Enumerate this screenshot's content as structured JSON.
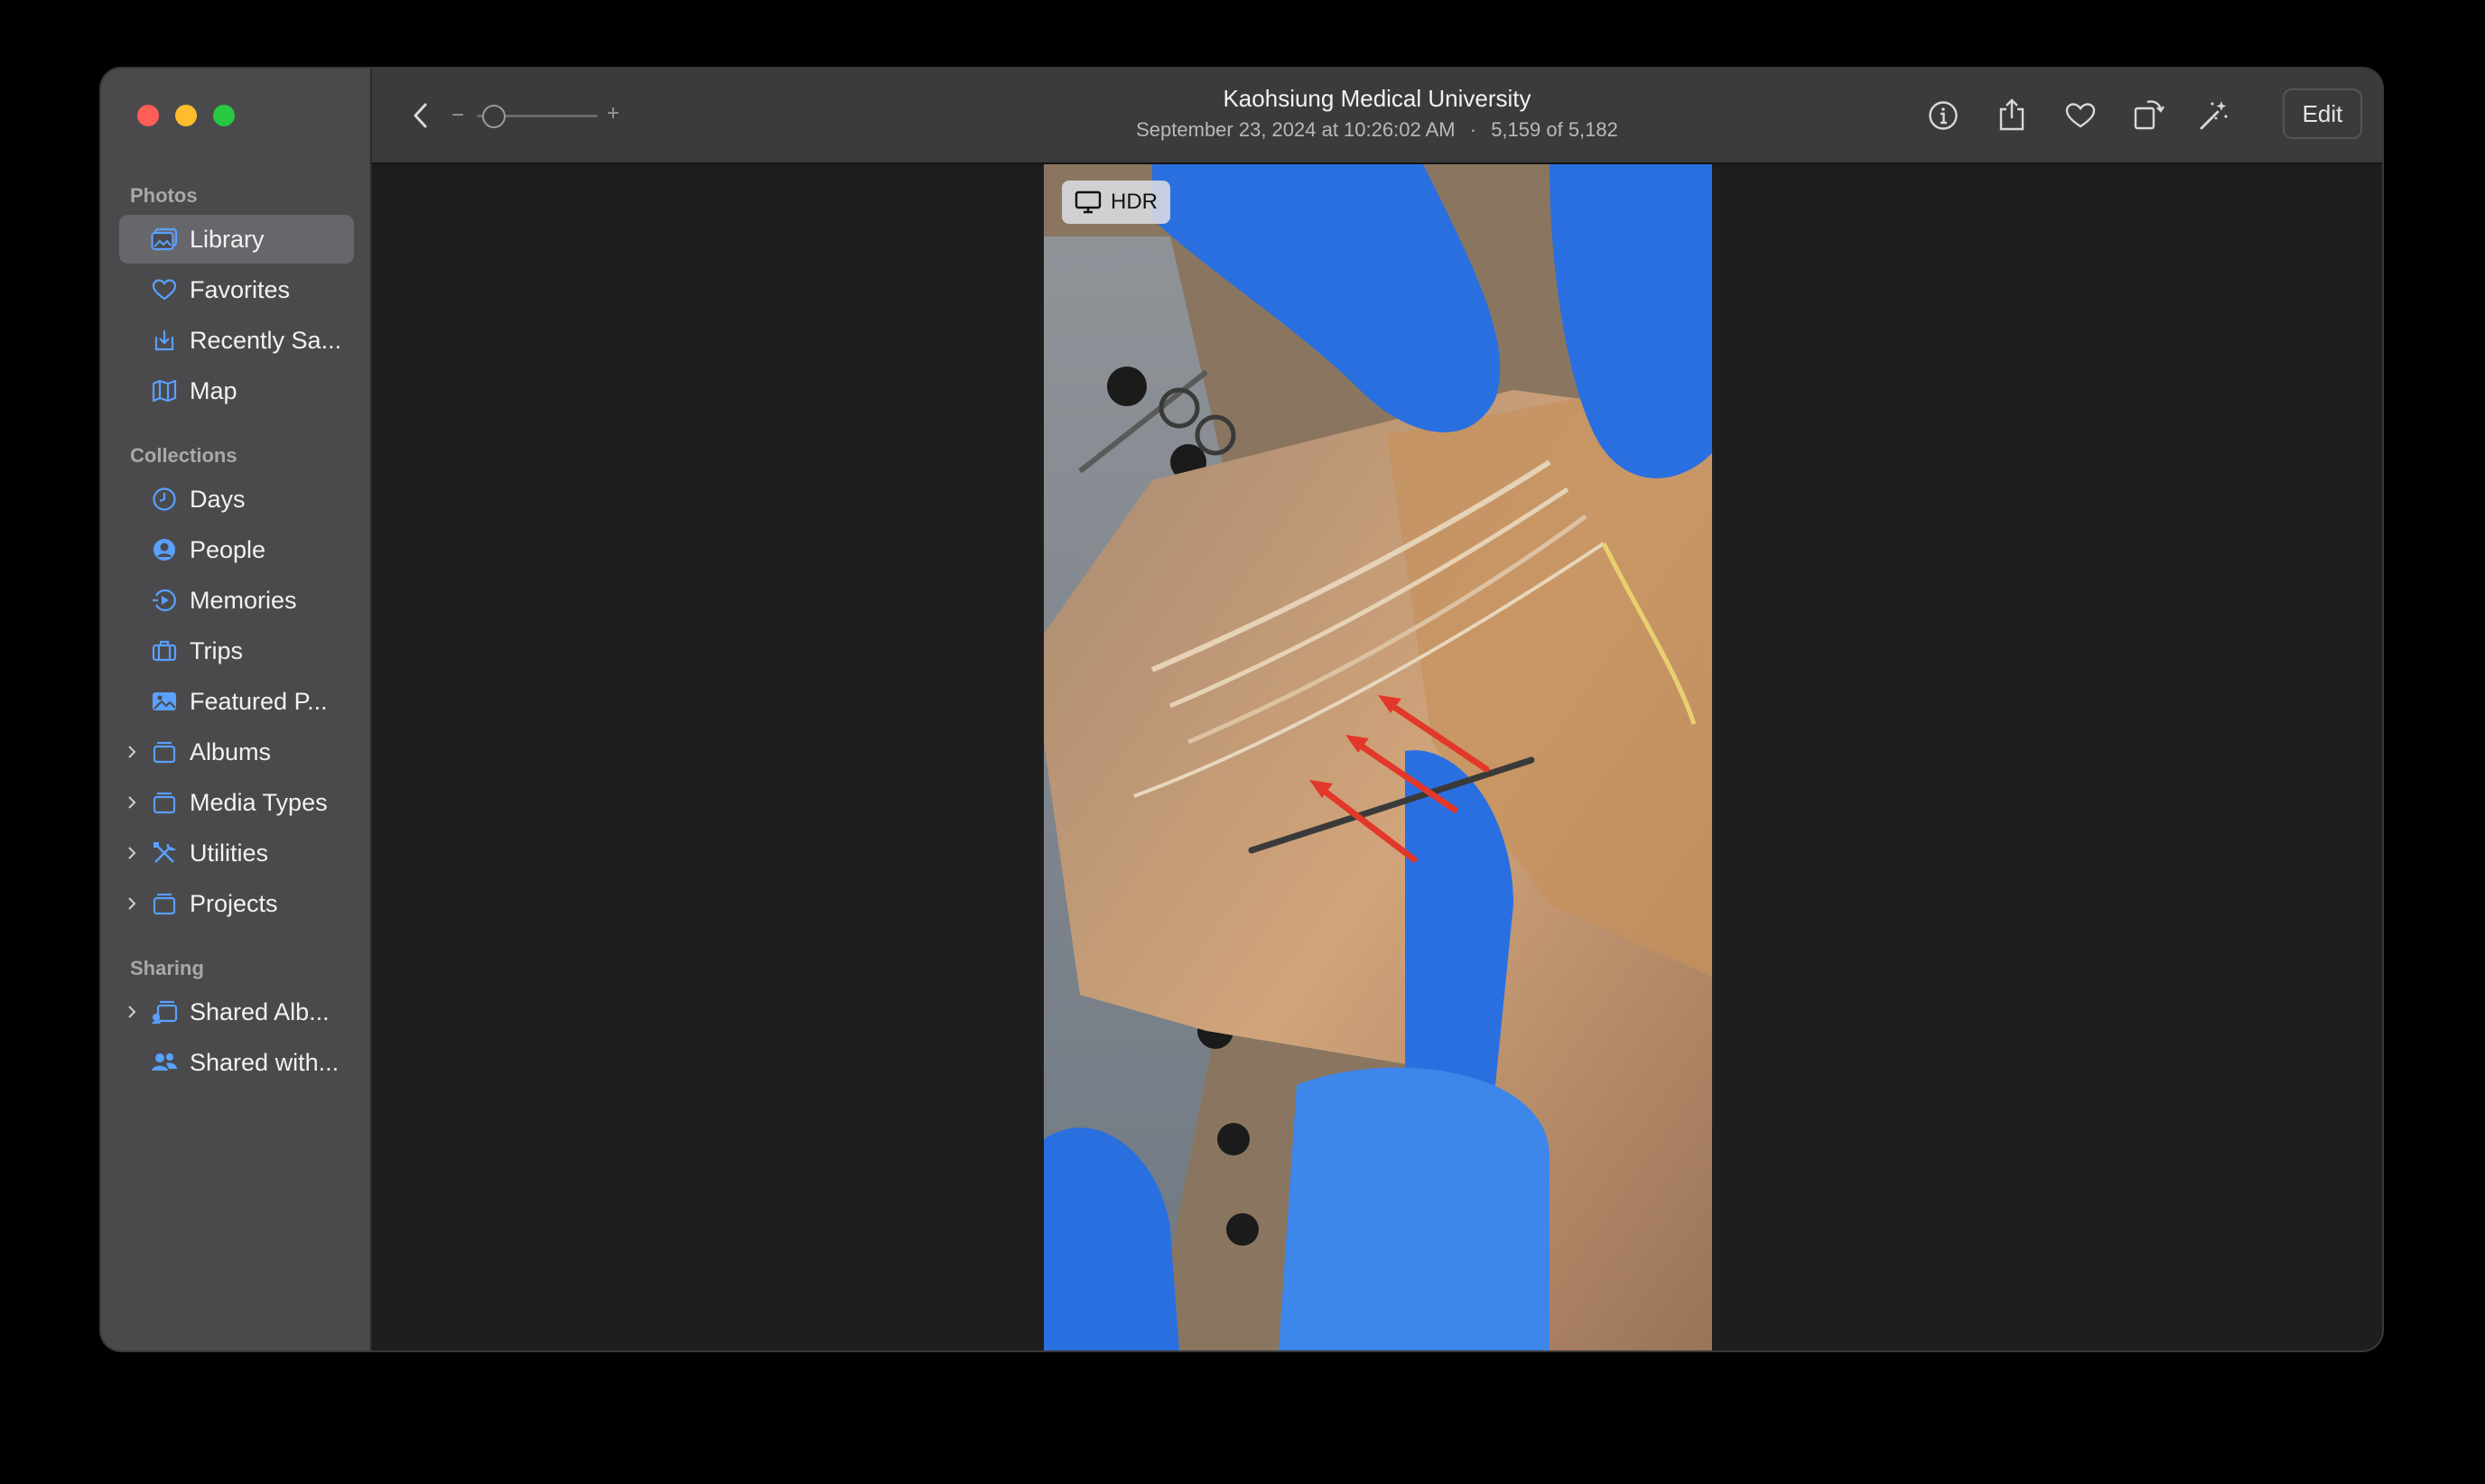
{
  "window": {
    "title": "Kaohsiung Medical University",
    "subtitle_date": "September 23, 2024 at 10:26:02 AM",
    "subtitle_sep": "·",
    "subtitle_position": "5,159 of 5,182"
  },
  "toolbar": {
    "zoom_minus": "−",
    "zoom_plus": "+",
    "zoom_level": 0.05,
    "edit_label": "Edit"
  },
  "sidebar": {
    "sections": [
      {
        "title": "Photos"
      },
      {
        "title": "Collections"
      },
      {
        "title": "Sharing"
      }
    ],
    "items": [
      {
        "label": "Library",
        "icon": "library-icon",
        "selected": true
      },
      {
        "label": "Favorites",
        "icon": "heart-icon"
      },
      {
        "label": "Recently Sa...",
        "icon": "recently-saved-icon"
      },
      {
        "label": "Map",
        "icon": "map-icon"
      },
      {
        "label": "Days",
        "icon": "clock-icon"
      },
      {
        "label": "People",
        "icon": "person-icon"
      },
      {
        "label": "Memories",
        "icon": "memories-icon"
      },
      {
        "label": "Trips",
        "icon": "suitcase-icon"
      },
      {
        "label": "Featured P...",
        "icon": "photo-icon"
      },
      {
        "label": "Albums",
        "icon": "folder-icon",
        "expandable": true
      },
      {
        "label": "Media Types",
        "icon": "folder-icon",
        "expandable": true
      },
      {
        "label": "Utilities",
        "icon": "tools-icon",
        "expandable": true
      },
      {
        "label": "Projects",
        "icon": "folder-icon",
        "expandable": true
      },
      {
        "label": "Shared Alb...",
        "icon": "shared-albums-icon",
        "expandable": true
      },
      {
        "label": "Shared with...",
        "icon": "shared-with-you-icon"
      }
    ]
  },
  "photo": {
    "badge": "HDR",
    "accent_glove": "#2a6fe0",
    "arrow_color": "#e2382a"
  }
}
